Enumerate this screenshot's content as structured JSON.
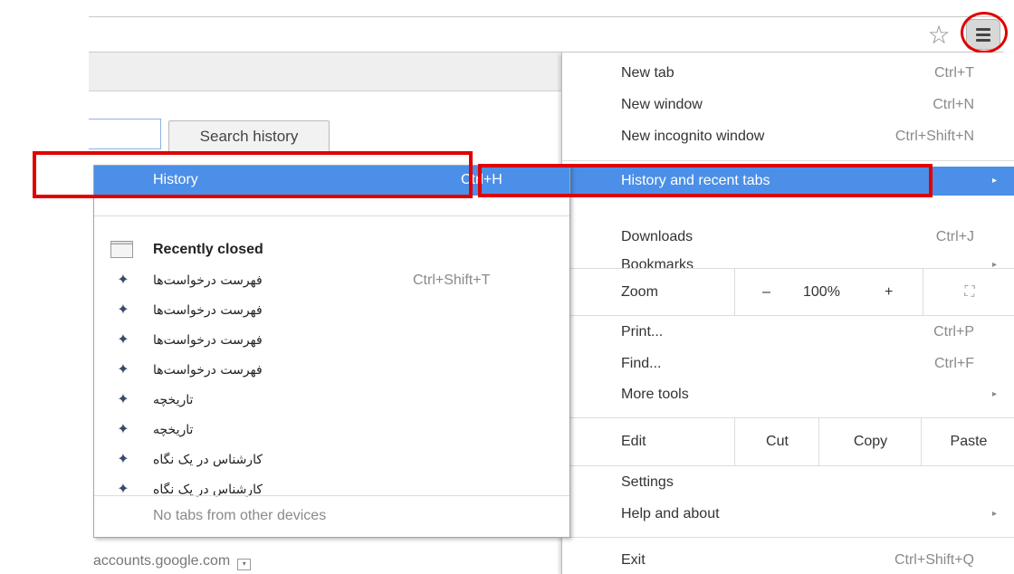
{
  "colors": {
    "highlight": "#4b8fe8",
    "annotation": "#e00000"
  },
  "toolbar": {
    "star_icon": "star-icon",
    "menu_icon": "hamburger-menu-icon"
  },
  "history_page": {
    "search_button": "Search history",
    "footer_url": "accounts.google.com"
  },
  "menu": {
    "new_tab": {
      "label": "New tab",
      "shortcut": "Ctrl+T"
    },
    "new_window": {
      "label": "New window",
      "shortcut": "Ctrl+N"
    },
    "new_incognito": {
      "label": "New incognito window",
      "shortcut": "Ctrl+Shift+N"
    },
    "history_recent": {
      "label": "History and recent tabs",
      "arrow": "▸"
    },
    "downloads": {
      "label": "Downloads",
      "shortcut": "Ctrl+J"
    },
    "bookmarks": {
      "label": "Bookmarks",
      "arrow": "▸"
    },
    "zoom": {
      "label": "Zoom",
      "minus": "–",
      "value": "100%",
      "plus": "+",
      "fullscreen": "⛶"
    },
    "print": {
      "label": "Print...",
      "shortcut": "Ctrl+P"
    },
    "find": {
      "label": "Find...",
      "shortcut": "Ctrl+F"
    },
    "more_tools": {
      "label": "More tools",
      "arrow": "▸"
    },
    "edit": {
      "label": "Edit",
      "cut": "Cut",
      "copy": "Copy",
      "paste": "Paste"
    },
    "settings": {
      "label": "Settings"
    },
    "help": {
      "label": "Help and about",
      "arrow": "▸"
    },
    "exit": {
      "label": "Exit",
      "shortcut": "Ctrl+Shift+Q"
    }
  },
  "submenu": {
    "history": {
      "label": "History",
      "shortcut": "Ctrl+H"
    },
    "recently_closed": "Recently closed",
    "items": [
      {
        "label": "فهرست درخواست‌ها",
        "shortcut": "Ctrl+Shift+T"
      },
      {
        "label": "فهرست درخواست‌ها",
        "shortcut": ""
      },
      {
        "label": "فهرست درخواست‌ها",
        "shortcut": ""
      },
      {
        "label": "فهرست درخواست‌ها",
        "shortcut": ""
      },
      {
        "label": "تاریخچه",
        "shortcut": ""
      },
      {
        "label": "تاریخچه",
        "shortcut": ""
      },
      {
        "label": "کارشناس در یک نگاه",
        "shortcut": ""
      },
      {
        "label": "کارشناس در یک نگاه",
        "shortcut": ""
      }
    ],
    "no_tabs": "No tabs from other devices"
  }
}
